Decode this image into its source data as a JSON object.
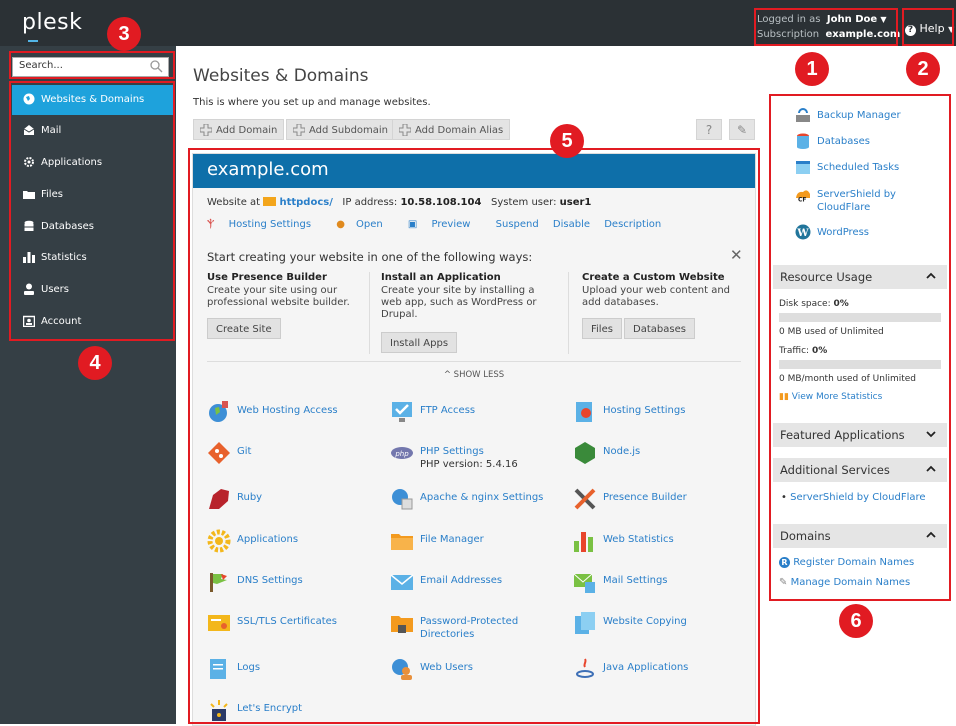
{
  "topbar": {
    "logo": "plesk",
    "logged_in_label": "Logged in as",
    "user_name": "John Doe",
    "subscription_label": "Subscription",
    "subscription_value": "example.com",
    "help_label": "Help"
  },
  "sidebar": {
    "search_placeholder": "Search...",
    "items": [
      {
        "label": "Websites & Domains",
        "icon": "globe-icon",
        "active": true
      },
      {
        "label": "Mail",
        "icon": "mail-icon",
        "active": false
      },
      {
        "label": "Applications",
        "icon": "gears-icon",
        "active": false
      },
      {
        "label": "Files",
        "icon": "folder-icon",
        "active": false
      },
      {
        "label": "Databases",
        "icon": "database-icon",
        "active": false
      },
      {
        "label": "Statistics",
        "icon": "bar-chart-icon",
        "active": false
      },
      {
        "label": "Users",
        "icon": "user-icon",
        "active": false
      },
      {
        "label": "Account",
        "icon": "account-icon",
        "active": false
      }
    ]
  },
  "main": {
    "title": "Websites & Domains",
    "subtitle": "This is where you set up and manage websites.",
    "toolbar": {
      "add_domain": "Add Domain",
      "add_subdomain": "Add Subdomain",
      "add_alias": "Add Domain Alias"
    },
    "domain_card": {
      "domain": "example.com",
      "website_at_label": "Website at",
      "docroot": "httpdocs/",
      "ip_label": "IP address:",
      "ip": "10.58.108.104",
      "sysuser_label": "System user:",
      "sysuser": "user1",
      "links": [
        "Hosting Settings",
        "Open",
        "Preview",
        "Suspend",
        "Disable",
        "Description"
      ],
      "start_title": "Start creating your website in one of the following ways:",
      "ways": [
        {
          "title": "Use Presence Builder",
          "text": "Create your site using our professional website builder.",
          "buttons": [
            "Create Site"
          ]
        },
        {
          "title": "Install an Application",
          "text": "Create your site by installing a web app, such as WordPress or Drupal.",
          "buttons": [
            "Install Apps"
          ]
        },
        {
          "title": "Create a Custom Website",
          "text": "Upload your web content and add databases.",
          "buttons": [
            "Files",
            "Databases"
          ]
        }
      ],
      "show_less": "SHOW LESS",
      "tiles": [
        {
          "label": "Web Hosting Access",
          "icon": "web-hosting-access-icon"
        },
        {
          "label": "FTP Access",
          "icon": "ftp-access-icon"
        },
        {
          "label": "Hosting Settings",
          "icon": "hosting-settings-icon"
        },
        {
          "label": "Git",
          "icon": "git-icon"
        },
        {
          "label": "PHP Settings",
          "sub": "PHP version: 5.4.16",
          "icon": "php-icon"
        },
        {
          "label": "Node.js",
          "icon": "nodejs-icon"
        },
        {
          "label": "Ruby",
          "icon": "ruby-icon"
        },
        {
          "label": "Apache & nginx Settings",
          "icon": "apache-nginx-icon"
        },
        {
          "label": "Presence Builder",
          "icon": "presence-builder-icon"
        },
        {
          "label": "Applications",
          "icon": "applications-icon"
        },
        {
          "label": "File Manager",
          "icon": "file-manager-icon"
        },
        {
          "label": "Web Statistics",
          "icon": "web-statistics-icon"
        },
        {
          "label": "DNS Settings",
          "icon": "dns-settings-icon"
        },
        {
          "label": "Email Addresses",
          "icon": "email-addresses-icon"
        },
        {
          "label": "Mail Settings",
          "icon": "mail-settings-icon"
        },
        {
          "label": "SSL/TLS Certificates",
          "icon": "ssl-certificate-icon"
        },
        {
          "label": "Password-Protected Directories",
          "icon": "protected-directories-icon"
        },
        {
          "label": "Website Copying",
          "icon": "website-copying-icon"
        },
        {
          "label": "Logs",
          "icon": "logs-icon"
        },
        {
          "label": "Web Users",
          "icon": "web-users-icon"
        },
        {
          "label": "Java Applications",
          "icon": "java-icon"
        },
        {
          "label": "Let's Encrypt",
          "icon": "lets-encrypt-icon"
        }
      ]
    }
  },
  "right_panel": {
    "links": [
      {
        "label": "Backup Manager",
        "icon": "backup-icon"
      },
      {
        "label": "Databases",
        "icon": "database-icon"
      },
      {
        "label": "Scheduled Tasks",
        "icon": "calendar-icon"
      },
      {
        "label": "ServerShield by CloudFlare",
        "icon": "cloudflare-icon"
      },
      {
        "label": "WordPress",
        "icon": "wordpress-icon"
      }
    ],
    "resource_usage": {
      "title": "Resource Usage",
      "disk_label": "Disk space:",
      "disk_value": "0%",
      "disk_used": "0 MB used of Unlimited",
      "traffic_label": "Traffic:",
      "traffic_value": "0%",
      "traffic_used": "0 MB/month used of Unlimited",
      "view_more": "View More Statistics"
    },
    "featured_title": "Featured Applications",
    "additional_title": "Additional Services",
    "additional_items": [
      "ServerShield by CloudFlare"
    ],
    "domains_title": "Domains",
    "domain_links": [
      "Register Domain Names",
      "Manage Domain Names"
    ]
  },
  "annotations": [
    "1",
    "2",
    "3",
    "4",
    "5",
    "6"
  ],
  "colors": {
    "topbar": "#2b3135",
    "sidebar": "#353f45",
    "active_nav": "#1ea2dc",
    "domain_header": "#0e6fa9",
    "link": "#2a7fc9",
    "annotation": "#e11b22"
  }
}
